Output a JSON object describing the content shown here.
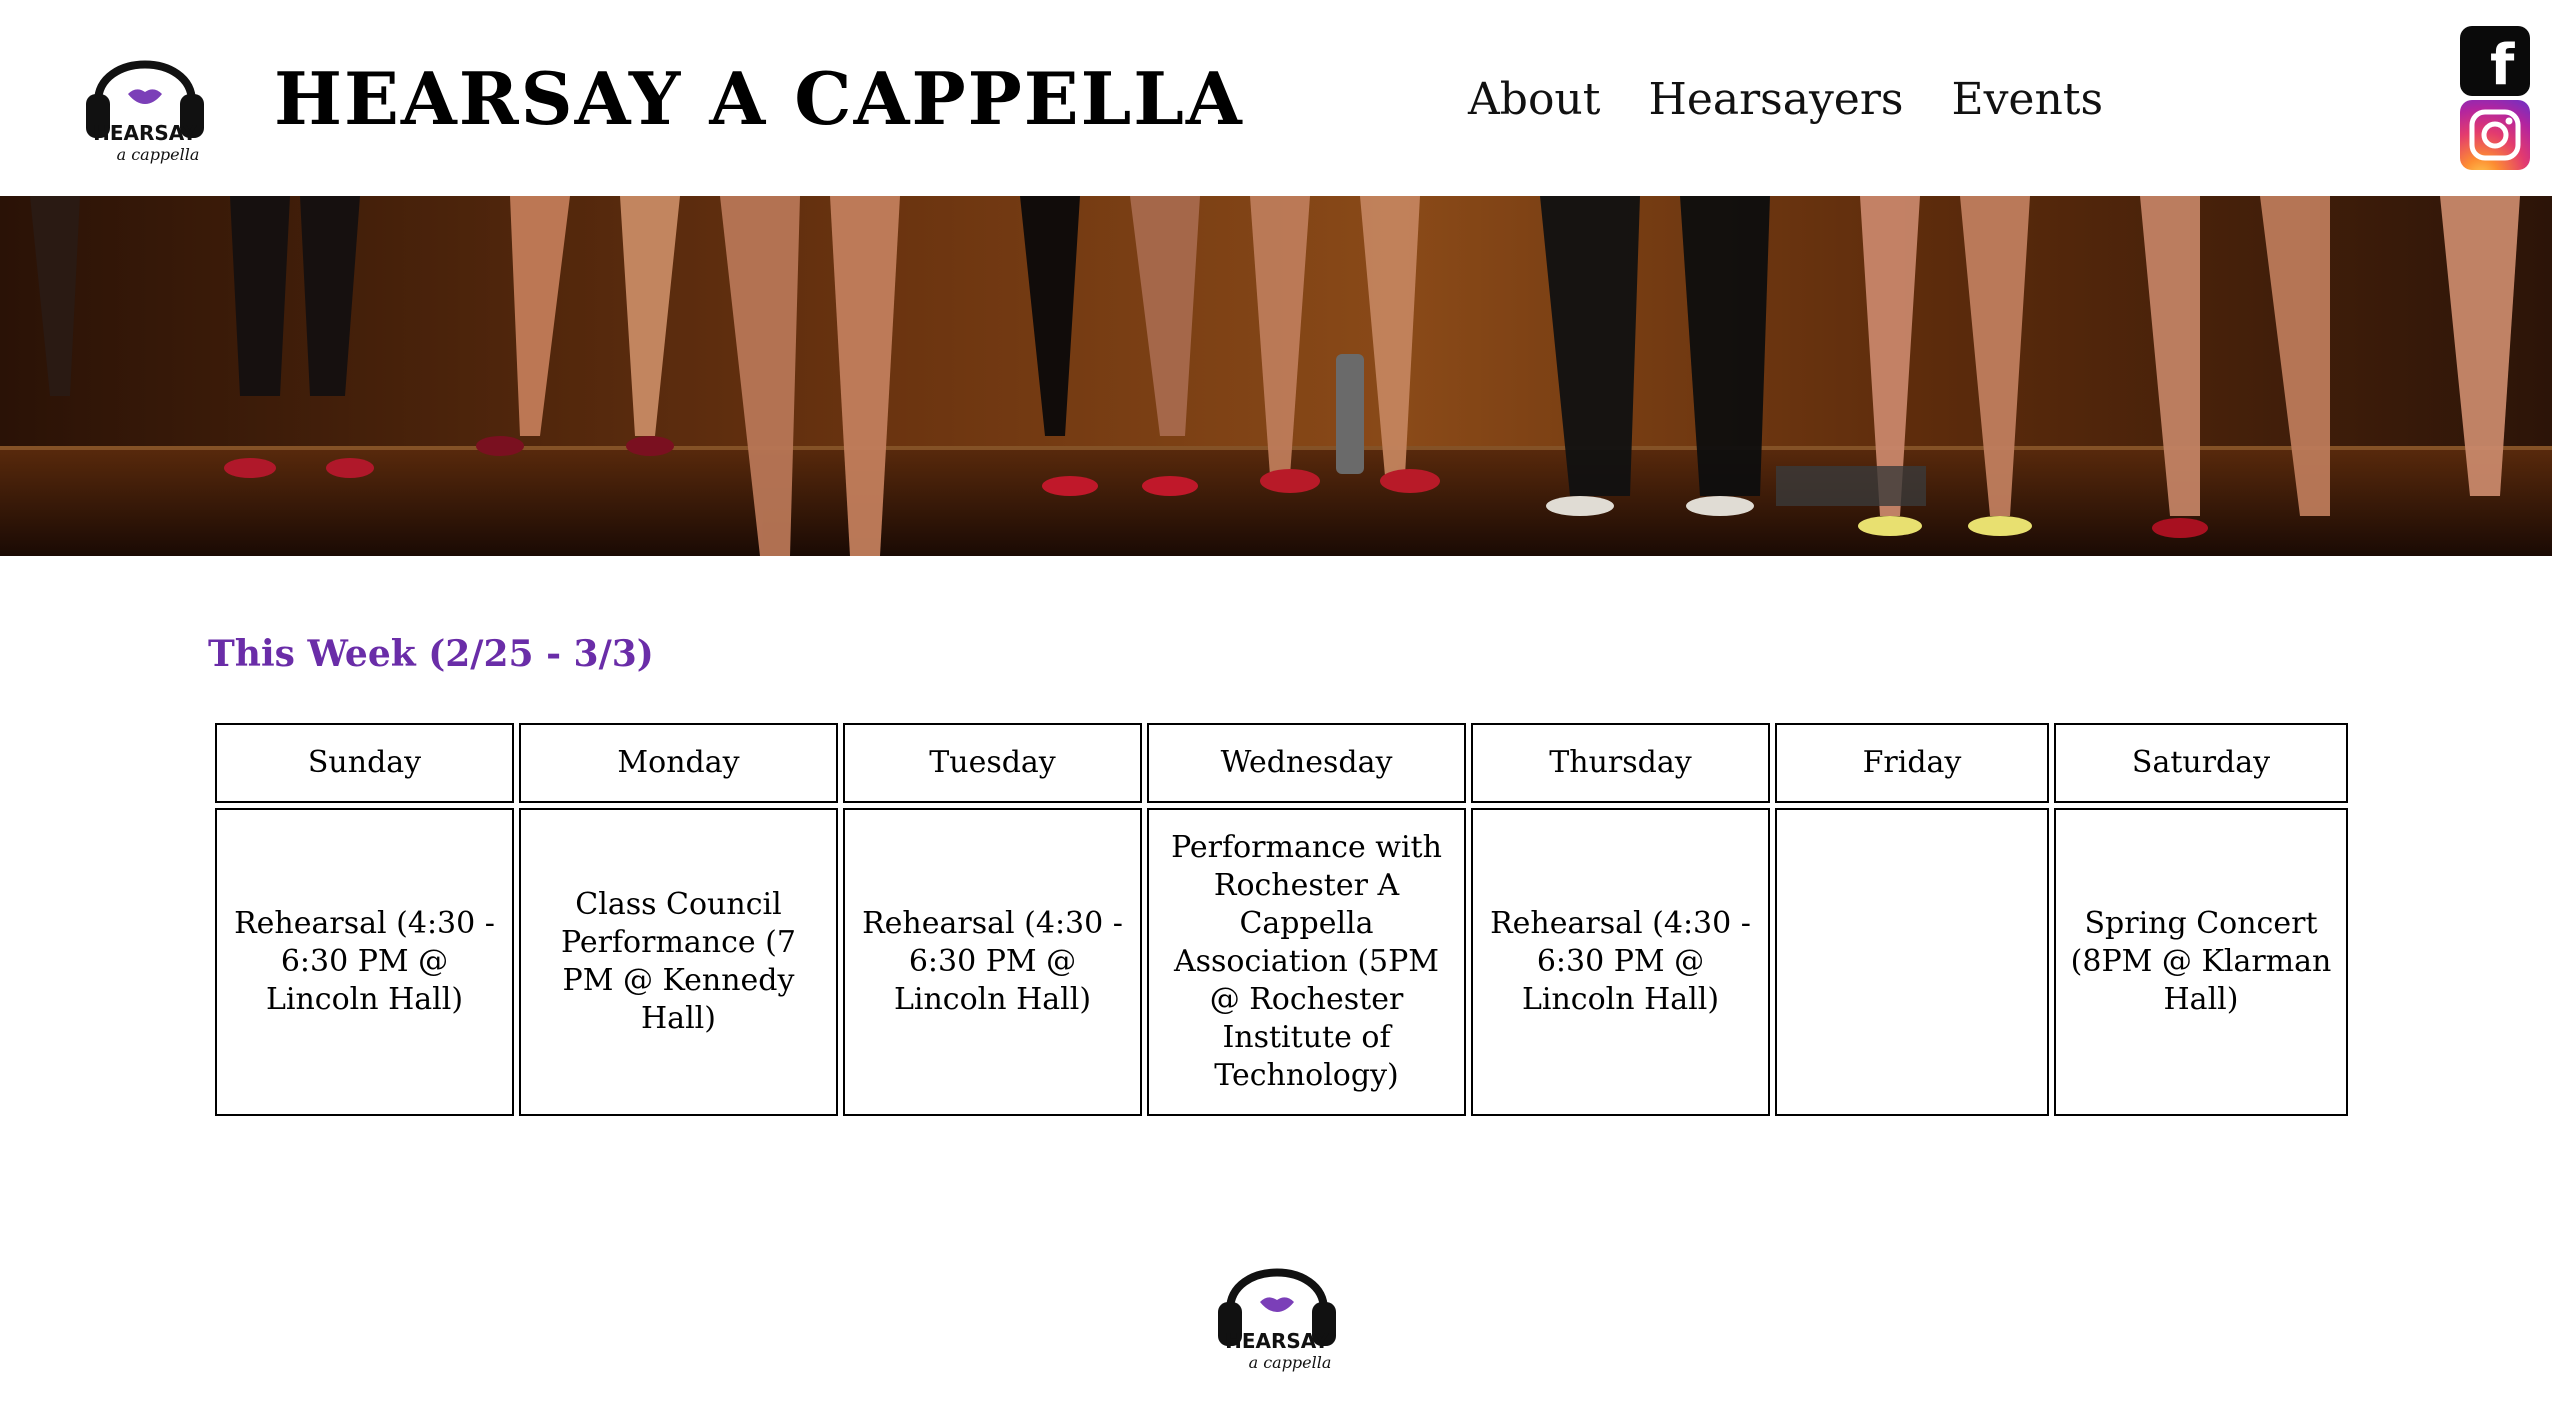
{
  "header": {
    "title": "HEARSAY A CAPPELLA",
    "logo_text_top": "HEARSAY",
    "logo_text_bottom": "a cappella",
    "nav": [
      {
        "label": "About"
      },
      {
        "label": "Hearsayers"
      },
      {
        "label": "Events"
      }
    ],
    "social": [
      {
        "icon": "facebook-icon",
        "glyph": "f"
      },
      {
        "icon": "instagram-icon"
      }
    ]
  },
  "banner": {
    "description_icon": "performers-legs-photo"
  },
  "week": {
    "heading": "This Week (2/25 - 3/3)",
    "days": [
      "Sunday",
      "Monday",
      "Tuesday",
      "Wednesday",
      "Thursday",
      "Friday",
      "Saturday"
    ],
    "events": [
      "Rehearsal (4:30 - 6:30 PM @ Lincoln Hall)",
      "Class Council Performance (7 PM @ Kennedy Hall)",
      "Rehearsal (4:30 - 6:30 PM @ Lincoln Hall)",
      "Performance with Rochester A Cappella Association (5PM @ Rochester Institute of Technology)",
      "Rehearsal (4:30 - 6:30 PM @ Lincoln Hall)",
      "",
      "Spring Concert (8PM @ Klarman Hall)"
    ]
  },
  "footer": {
    "logo_text_top": "HEARSAY",
    "logo_text_bottom": "a cappella"
  },
  "colors": {
    "accent": "#6a2da8",
    "lips": "#7b3fb8"
  }
}
